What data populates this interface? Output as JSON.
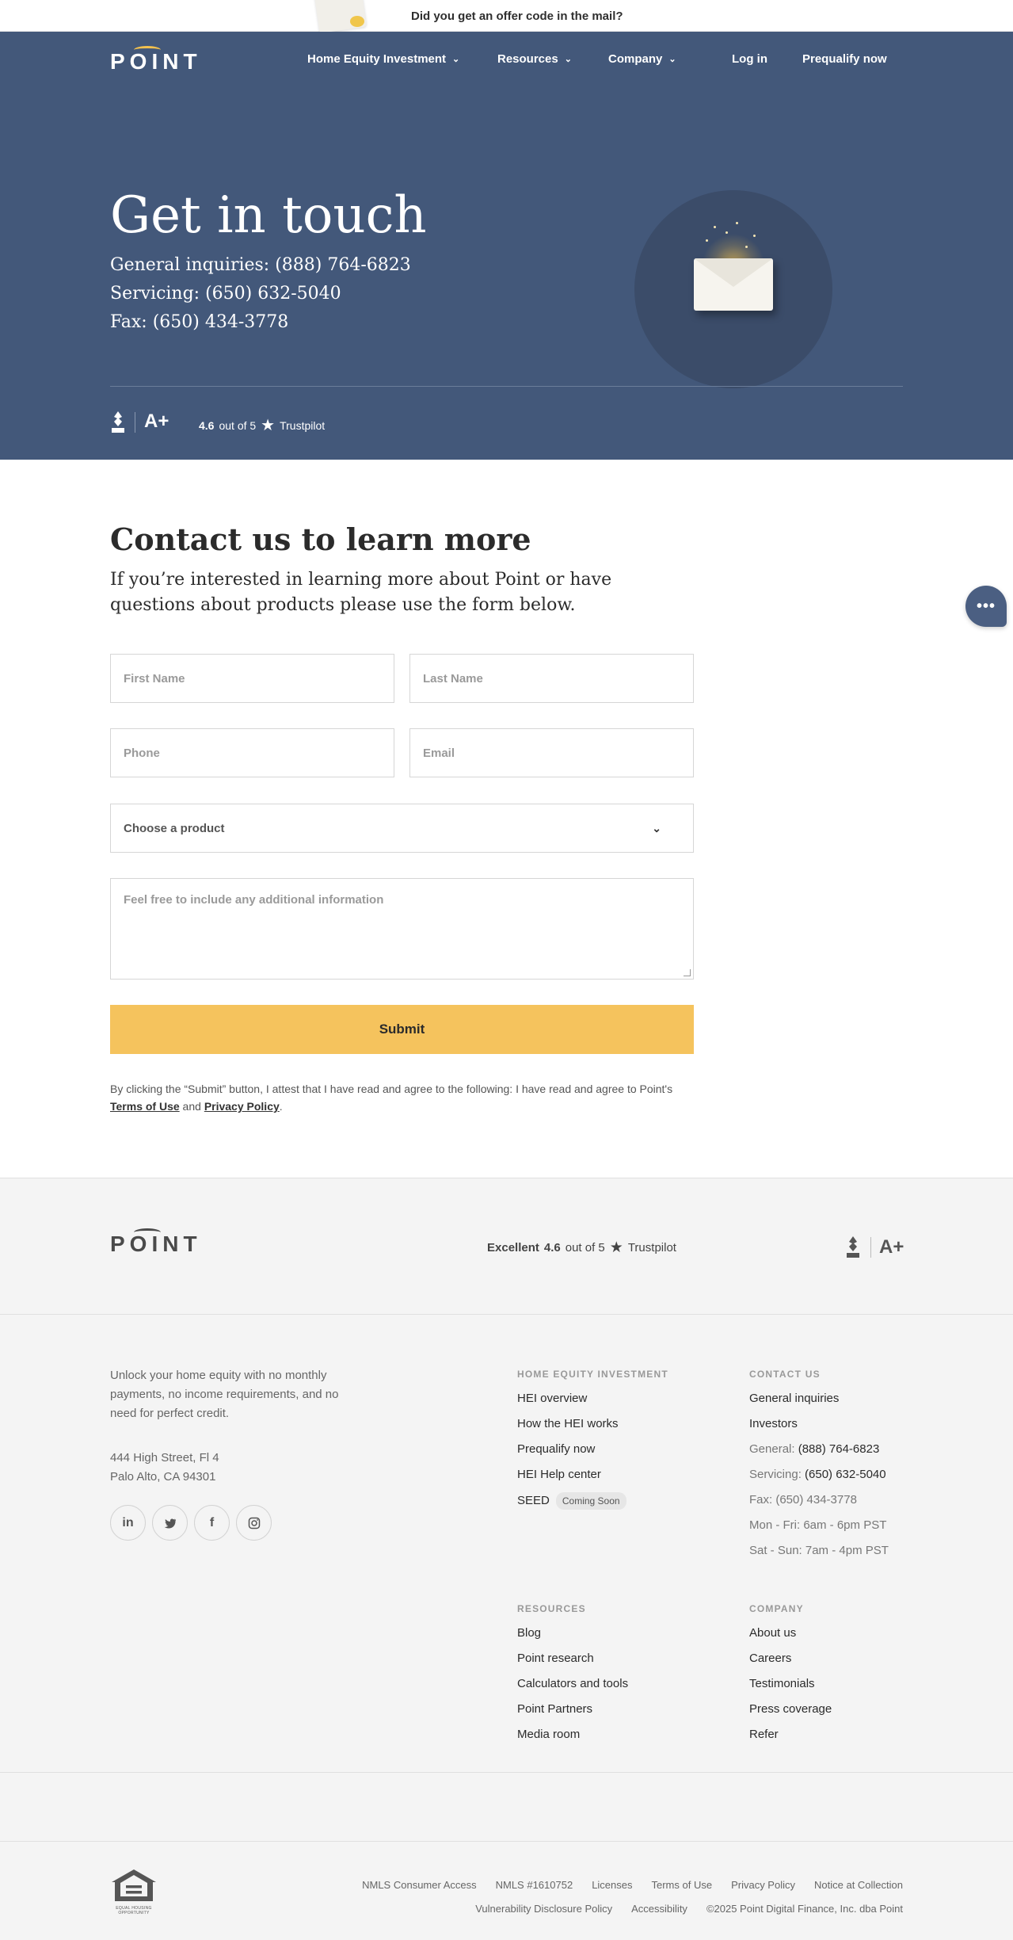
{
  "banner": {
    "text": "Did you get an offer code in the mail?"
  },
  "header": {
    "logo": "POINT",
    "nav": [
      {
        "label": "Home Equity Investment"
      },
      {
        "label": "Resources"
      },
      {
        "label": "Company"
      }
    ],
    "login": "Log in",
    "prequalify": "Prequalify now"
  },
  "hero": {
    "title": "Get in touch",
    "lines": [
      "General inquiries: (888) 764-6823",
      "Servicing: (650) 632-5040",
      "Fax: (650) 434-3778"
    ],
    "bbb_rating": "A+",
    "bbb_label": "BBB",
    "trustpilot_score": "4.6",
    "trustpilot_suffix": "out of 5",
    "trustpilot_brand": "Trustpilot"
  },
  "contact": {
    "title": "Contact us to learn more",
    "subtitle": "If you’re interested in learning more about Point or have questions about products please use the form below.",
    "first_name_placeholder": "First Name",
    "last_name_placeholder": "Last Name",
    "phone_placeholder": "Phone",
    "email_placeholder": "Email",
    "product_select": "Choose a product",
    "info_placeholder": "Feel free to include any additional information",
    "submit": "Submit",
    "legal_prefix": "By clicking the “Submit” button, I attest that I have read and agree to the following: I have read and agree to Point's ",
    "legal_terms": "Terms of Use",
    "legal_and": " and ",
    "legal_privacy": "Privacy Policy",
    "legal_end": "."
  },
  "chat": {
    "label": "•••"
  },
  "footer": {
    "logo": "POINT",
    "tp_excellent": "Excellent",
    "tp_score": "4.6",
    "tp_suffix": "out of 5",
    "tp_brand": "Trustpilot",
    "bbb_rating": "A+",
    "bbb_label": "BBB",
    "blurb": "Unlock your home equity with no monthly payments, no income requirements, and no need for perfect credit.",
    "address_line1": "444 High Street, Fl 4",
    "address_line2": "Palo Alto, CA 94301",
    "socials": [
      {
        "name": "linkedin-icon",
        "glyph": "in"
      },
      {
        "name": "twitter-icon",
        "glyph": "𝕥"
      },
      {
        "name": "facebook-icon",
        "glyph": "f"
      },
      {
        "name": "instagram-icon",
        "glyph": "◎"
      }
    ],
    "hei": {
      "heading": "HOME EQUITY INVESTMENT",
      "items": [
        "HEI overview",
        "How the HEI works",
        "Prequalify now",
        "HEI Help center",
        "SEED"
      ],
      "seed_chip": "Coming Soon"
    },
    "contact": {
      "heading": "CONTACT US",
      "general_inquiries": "General inquiries",
      "investors": "Investors",
      "general_label": "General:",
      "general_phone": "(888) 764-6823",
      "servicing_label": "Servicing:",
      "servicing_phone": "(650) 632-5040",
      "fax": "Fax: (650) 434-3778",
      "hours_weekday": "Mon - Fri: 6am - 6pm PST",
      "hours_weekend": "Sat - Sun: 7am - 4pm PST"
    },
    "resources": {
      "heading": "RESOURCES",
      "items": [
        "Blog",
        "Point research",
        "Calculators and tools",
        "Point Partners",
        "Media room"
      ]
    },
    "company": {
      "heading": "COMPANY",
      "items": [
        "About us",
        "Careers",
        "Testimonials",
        "Press coverage",
        "Refer"
      ]
    },
    "ehl_text": "EQUAL HOUSING OPPORTUNITY",
    "bottom_row1": [
      "NMLS Consumer Access",
      "NMLS #1610752",
      "Licenses",
      "Terms of Use",
      "Privacy Policy",
      "Notice at Collection"
    ],
    "bottom_row2": [
      "Vulnerability Disclosure Policy",
      "Accessibility",
      "©2025 Point Digital Finance, Inc. dba Point"
    ]
  }
}
